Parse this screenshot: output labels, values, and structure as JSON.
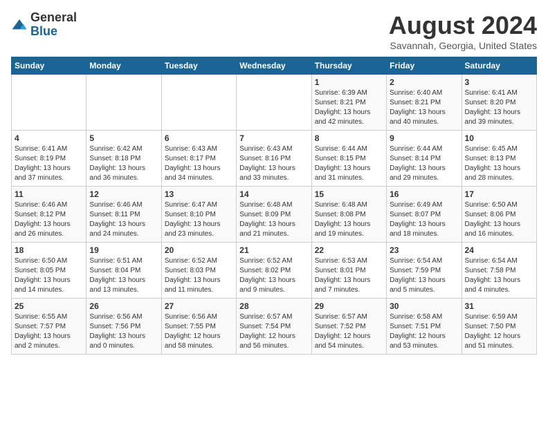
{
  "logo": {
    "general": "General",
    "blue": "Blue"
  },
  "title": "August 2024",
  "location": "Savannah, Georgia, United States",
  "days_of_week": [
    "Sunday",
    "Monday",
    "Tuesday",
    "Wednesday",
    "Thursday",
    "Friday",
    "Saturday"
  ],
  "weeks": [
    [
      {
        "day": "",
        "sunrise": "",
        "sunset": "",
        "daylight": ""
      },
      {
        "day": "",
        "sunrise": "",
        "sunset": "",
        "daylight": ""
      },
      {
        "day": "",
        "sunrise": "",
        "sunset": "",
        "daylight": ""
      },
      {
        "day": "",
        "sunrise": "",
        "sunset": "",
        "daylight": ""
      },
      {
        "day": "1",
        "sunrise": "Sunrise: 6:39 AM",
        "sunset": "Sunset: 8:21 PM",
        "daylight": "Daylight: 13 hours and 42 minutes."
      },
      {
        "day": "2",
        "sunrise": "Sunrise: 6:40 AM",
        "sunset": "Sunset: 8:21 PM",
        "daylight": "Daylight: 13 hours and 40 minutes."
      },
      {
        "day": "3",
        "sunrise": "Sunrise: 6:41 AM",
        "sunset": "Sunset: 8:20 PM",
        "daylight": "Daylight: 13 hours and 39 minutes."
      }
    ],
    [
      {
        "day": "4",
        "sunrise": "Sunrise: 6:41 AM",
        "sunset": "Sunset: 8:19 PM",
        "daylight": "Daylight: 13 hours and 37 minutes."
      },
      {
        "day": "5",
        "sunrise": "Sunrise: 6:42 AM",
        "sunset": "Sunset: 8:18 PM",
        "daylight": "Daylight: 13 hours and 36 minutes."
      },
      {
        "day": "6",
        "sunrise": "Sunrise: 6:43 AM",
        "sunset": "Sunset: 8:17 PM",
        "daylight": "Daylight: 13 hours and 34 minutes."
      },
      {
        "day": "7",
        "sunrise": "Sunrise: 6:43 AM",
        "sunset": "Sunset: 8:16 PM",
        "daylight": "Daylight: 13 hours and 33 minutes."
      },
      {
        "day": "8",
        "sunrise": "Sunrise: 6:44 AM",
        "sunset": "Sunset: 8:15 PM",
        "daylight": "Daylight: 13 hours and 31 minutes."
      },
      {
        "day": "9",
        "sunrise": "Sunrise: 6:44 AM",
        "sunset": "Sunset: 8:14 PM",
        "daylight": "Daylight: 13 hours and 29 minutes."
      },
      {
        "day": "10",
        "sunrise": "Sunrise: 6:45 AM",
        "sunset": "Sunset: 8:13 PM",
        "daylight": "Daylight: 13 hours and 28 minutes."
      }
    ],
    [
      {
        "day": "11",
        "sunrise": "Sunrise: 6:46 AM",
        "sunset": "Sunset: 8:12 PM",
        "daylight": "Daylight: 13 hours and 26 minutes."
      },
      {
        "day": "12",
        "sunrise": "Sunrise: 6:46 AM",
        "sunset": "Sunset: 8:11 PM",
        "daylight": "Daylight: 13 hours and 24 minutes."
      },
      {
        "day": "13",
        "sunrise": "Sunrise: 6:47 AM",
        "sunset": "Sunset: 8:10 PM",
        "daylight": "Daylight: 13 hours and 23 minutes."
      },
      {
        "day": "14",
        "sunrise": "Sunrise: 6:48 AM",
        "sunset": "Sunset: 8:09 PM",
        "daylight": "Daylight: 13 hours and 21 minutes."
      },
      {
        "day": "15",
        "sunrise": "Sunrise: 6:48 AM",
        "sunset": "Sunset: 8:08 PM",
        "daylight": "Daylight: 13 hours and 19 minutes."
      },
      {
        "day": "16",
        "sunrise": "Sunrise: 6:49 AM",
        "sunset": "Sunset: 8:07 PM",
        "daylight": "Daylight: 13 hours and 18 minutes."
      },
      {
        "day": "17",
        "sunrise": "Sunrise: 6:50 AM",
        "sunset": "Sunset: 8:06 PM",
        "daylight": "Daylight: 13 hours and 16 minutes."
      }
    ],
    [
      {
        "day": "18",
        "sunrise": "Sunrise: 6:50 AM",
        "sunset": "Sunset: 8:05 PM",
        "daylight": "Daylight: 13 hours and 14 minutes."
      },
      {
        "day": "19",
        "sunrise": "Sunrise: 6:51 AM",
        "sunset": "Sunset: 8:04 PM",
        "daylight": "Daylight: 13 hours and 13 minutes."
      },
      {
        "day": "20",
        "sunrise": "Sunrise: 6:52 AM",
        "sunset": "Sunset: 8:03 PM",
        "daylight": "Daylight: 13 hours and 11 minutes."
      },
      {
        "day": "21",
        "sunrise": "Sunrise: 6:52 AM",
        "sunset": "Sunset: 8:02 PM",
        "daylight": "Daylight: 13 hours and 9 minutes."
      },
      {
        "day": "22",
        "sunrise": "Sunrise: 6:53 AM",
        "sunset": "Sunset: 8:01 PM",
        "daylight": "Daylight: 13 hours and 7 minutes."
      },
      {
        "day": "23",
        "sunrise": "Sunrise: 6:54 AM",
        "sunset": "Sunset: 7:59 PM",
        "daylight": "Daylight: 13 hours and 5 minutes."
      },
      {
        "day": "24",
        "sunrise": "Sunrise: 6:54 AM",
        "sunset": "Sunset: 7:58 PM",
        "daylight": "Daylight: 13 hours and 4 minutes."
      }
    ],
    [
      {
        "day": "25",
        "sunrise": "Sunrise: 6:55 AM",
        "sunset": "Sunset: 7:57 PM",
        "daylight": "Daylight: 13 hours and 2 minutes."
      },
      {
        "day": "26",
        "sunrise": "Sunrise: 6:56 AM",
        "sunset": "Sunset: 7:56 PM",
        "daylight": "Daylight: 13 hours and 0 minutes."
      },
      {
        "day": "27",
        "sunrise": "Sunrise: 6:56 AM",
        "sunset": "Sunset: 7:55 PM",
        "daylight": "Daylight: 12 hours and 58 minutes."
      },
      {
        "day": "28",
        "sunrise": "Sunrise: 6:57 AM",
        "sunset": "Sunset: 7:54 PM",
        "daylight": "Daylight: 12 hours and 56 minutes."
      },
      {
        "day": "29",
        "sunrise": "Sunrise: 6:57 AM",
        "sunset": "Sunset: 7:52 PM",
        "daylight": "Daylight: 12 hours and 54 minutes."
      },
      {
        "day": "30",
        "sunrise": "Sunrise: 6:58 AM",
        "sunset": "Sunset: 7:51 PM",
        "daylight": "Daylight: 12 hours and 53 minutes."
      },
      {
        "day": "31",
        "sunrise": "Sunrise: 6:59 AM",
        "sunset": "Sunset: 7:50 PM",
        "daylight": "Daylight: 12 hours and 51 minutes."
      }
    ]
  ]
}
